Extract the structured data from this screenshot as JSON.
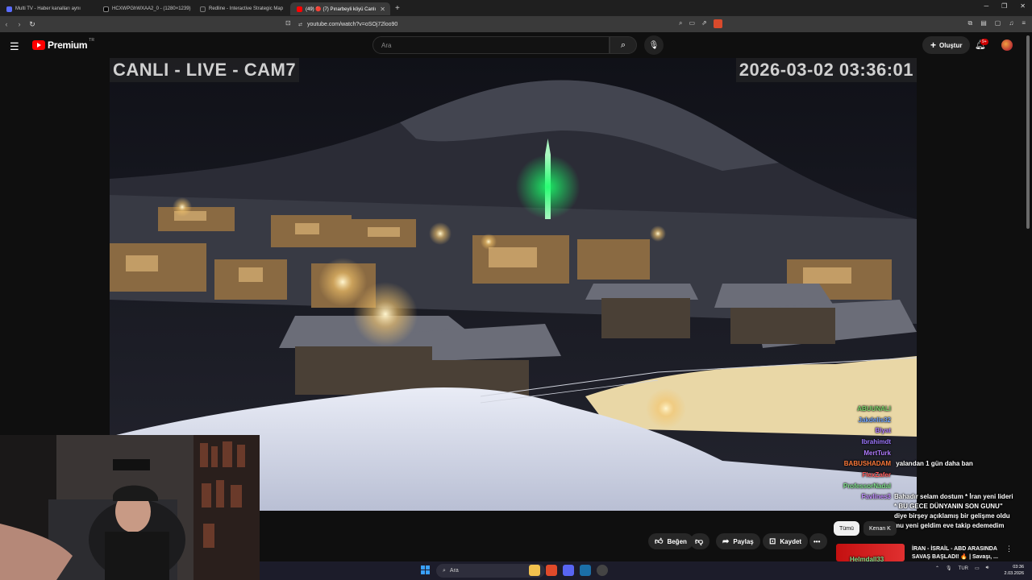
{
  "browser": {
    "tabs": [
      {
        "label": "Multi TV - Haber kanalları aynı",
        "active": false
      },
      {
        "label": "HCXWPGhWXAA2_0 - (1280×1239)",
        "active": false
      },
      {
        "label": "Redline - Interactive Strategic Map",
        "active": false
      },
      {
        "label": "(49) 🔴 (7) Pınarbeyli köyü Canlı",
        "active": true
      }
    ],
    "url": "youtube.com/watch?v=oSOj72loo90"
  },
  "youtube": {
    "brand": "Premium",
    "country": "TR",
    "search_placeholder": "Ara",
    "create_label": "Oluştur",
    "notif_count": "9+"
  },
  "video": {
    "cam_label": "CANLI - LIVE - CAM7",
    "timestamp": "2026-03-02 03:36:01"
  },
  "chat": {
    "lines": [
      {
        "user": "ABUUNALI",
        "text": "",
        "color": "#7ad36b"
      },
      {
        "user": "Jakdelis32",
        "text": "",
        "color": "#6fa3ff"
      },
      {
        "user": "Blyat",
        "text": "",
        "color": "#b07cff"
      },
      {
        "user": "Ibrahimdt",
        "text": "",
        "color": "#9e78ff"
      },
      {
        "user": "MertTurk",
        "text": "",
        "color": "#b27cff"
      },
      {
        "user": "BABUSHADAM",
        "text": "yalandan 1 gün daha ban",
        "color": "#ff7a3a"
      },
      {
        "user": "FlexZafer",
        "text": "",
        "color": "#ff5a5a"
      },
      {
        "user": "ProfessorNadal",
        "text": "",
        "color": "#7fe08a"
      },
      {
        "user": "Favlines3",
        "text": "",
        "color": "#c08cff"
      }
    ],
    "long_message": "Bahadır selam dostum * İran yeni lideri * BU GECE DÜNYANIN SON GUNU\" diye birşey açıklamış bir gelişme oldu mu yeni geldim eve takip edemedim",
    "bottom_user": "sahradymzz",
    "bottom_user2": "Helmdall33"
  },
  "actions": {
    "like": "Beğen",
    "share": "Paylaş",
    "save": "Kaydet",
    "more": "•••"
  },
  "filters": {
    "all": "Tümü",
    "next": "Kenan K"
  },
  "news": {
    "headline": "İRAN - İSRAİL - ABD ARASINDA SAVAŞ BAŞLADI! 🔥 | Savaşı, ..."
  },
  "taskbar": {
    "search": "Ara",
    "lang": "TUR",
    "time": "03:36",
    "date": "2.03.2026"
  },
  "colors": {
    "youtube_red": "#ff0000",
    "accent_green": "#1aff6a"
  }
}
